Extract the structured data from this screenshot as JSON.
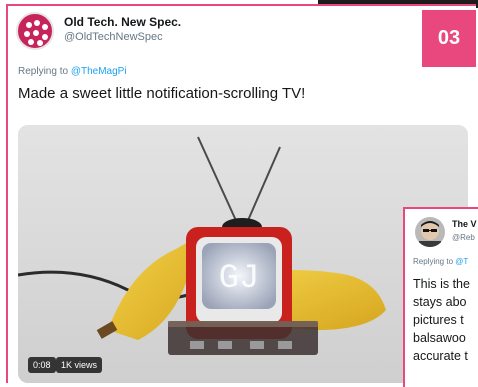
{
  "colors": {
    "accent": "#e8487e",
    "link": "#1da1f2",
    "muted": "#657786",
    "text": "#14171a"
  },
  "badge": {
    "number": "03"
  },
  "tweet": {
    "author_name": "Old Tech. New Spec.",
    "author_handle": "@OldTechNewSpec",
    "replying_label": "Replying to",
    "replying_to": "@TheMagPi",
    "text": "Made a sweet little notification-scrolling TV!",
    "media": {
      "duration": "0:08",
      "views": "1K views"
    }
  },
  "tweet2": {
    "author_name": "The V",
    "author_handle": "@Reb",
    "replying_label": "Replying to",
    "replying_to": "@T",
    "lines": [
      "This is the",
      "stays abo",
      "pictures t",
      "balsawoo",
      "accurate t"
    ]
  }
}
